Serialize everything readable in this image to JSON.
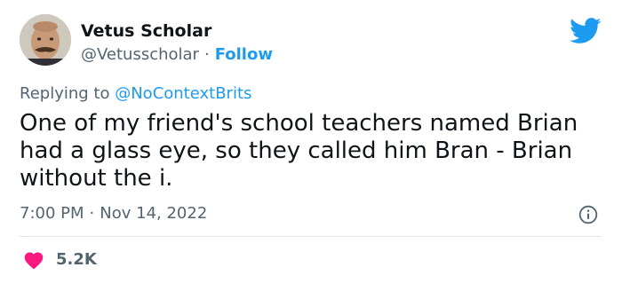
{
  "author": {
    "display_name": "Vetus Scholar",
    "handle": "@Vetusscholar",
    "separator": "·",
    "follow_label": "Follow"
  },
  "reply": {
    "prefix": "Replying to",
    "mention": "@NoContextBrits"
  },
  "tweet": {
    "text": "One of my friend's school teachers named Brian had a glass eye, so they called him Bran - Brian without the i."
  },
  "meta": {
    "time": "7:00 PM",
    "separator": "·",
    "date": "Nov 14, 2022"
  },
  "engagement": {
    "like_count": "5.2K"
  },
  "colors": {
    "accent": "#1d9bf0",
    "like": "#f91880",
    "text": "#0f1419",
    "muted": "#536471"
  },
  "icons": {
    "brand": "twitter-bird-icon",
    "info": "info-icon",
    "like": "heart-icon"
  }
}
